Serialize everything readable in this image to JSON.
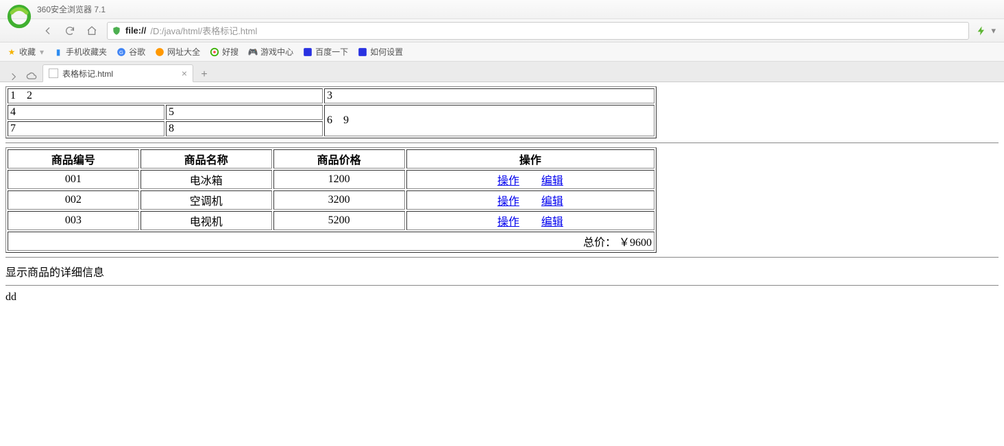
{
  "app": {
    "title": "360安全浏览器 7.1"
  },
  "url": {
    "protocol": "file://",
    "path": "/D:/java/html/表格标记.html"
  },
  "bookmarks": {
    "fav": "收藏",
    "items": [
      {
        "label": "手机收藏夹"
      },
      {
        "label": "谷歌"
      },
      {
        "label": "网址大全"
      },
      {
        "label": "好搜"
      },
      {
        "label": "游戏中心"
      },
      {
        "label": "百度一下"
      },
      {
        "label": "如何设置"
      }
    ]
  },
  "tab": {
    "title": "表格标记.html"
  },
  "table1": {
    "cells": {
      "c1": "1",
      "c2": "2",
      "c3": "3",
      "c4": "4",
      "c5": "5",
      "c6": "6",
      "c7": "7",
      "c8": "8",
      "c9": "9"
    }
  },
  "table2": {
    "headers": {
      "h1": "商品编号",
      "h2": "商品名称",
      "h3": "商品价格",
      "h4": "操作"
    },
    "rows": [
      {
        "id": "001",
        "name": "电冰箱",
        "price": "1200"
      },
      {
        "id": "002",
        "name": "空调机",
        "price": "3200"
      },
      {
        "id": "003",
        "name": "电视机",
        "price": "5200"
      }
    ],
    "op_label": "操作",
    "edit_label": "编辑",
    "total": "总价： ￥9600"
  },
  "detail_text": "显示商品的详细信息",
  "dd_text": "dd"
}
